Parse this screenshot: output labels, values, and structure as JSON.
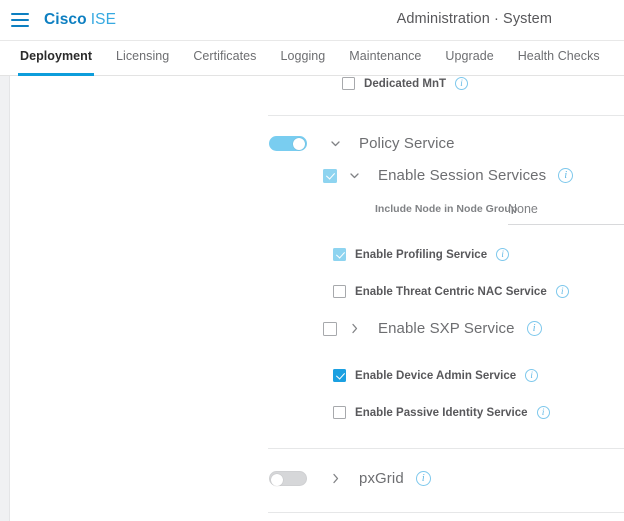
{
  "header": {
    "menu_icon": "hamburger-menu-icon",
    "brand_primary": "Cisco",
    "brand_secondary": "ISE",
    "breadcrumb": "Administration · System"
  },
  "tabs": [
    {
      "label": "Deployment",
      "active": true
    },
    {
      "label": "Licensing",
      "active": false
    },
    {
      "label": "Certificates",
      "active": false
    },
    {
      "label": "Logging",
      "active": false
    },
    {
      "label": "Maintenance",
      "active": false
    },
    {
      "label": "Upgrade",
      "active": false
    },
    {
      "label": "Health Checks",
      "active": false
    }
  ],
  "form": {
    "dedicated_mnt": {
      "label": "Dedicated MnT",
      "checked": false,
      "info_icon": "info-icon"
    },
    "policy_service": {
      "label": "Policy Service",
      "toggle_state": "on",
      "chevron": "chevron-down-icon"
    },
    "session_services": {
      "label": "Enable Session Services",
      "checked": true,
      "chevron": "chevron-down-icon",
      "info_icon": "info-icon"
    },
    "node_group": {
      "label": "Include Node in Node Group",
      "value": "None"
    },
    "profiling_service": {
      "label": "Enable Profiling Service",
      "checked": true,
      "info_icon": "info-icon"
    },
    "threat_centric_nac": {
      "label": "Enable Threat Centric NAC Service",
      "checked": false,
      "info_icon": "info-icon"
    },
    "sxp_service": {
      "label": "Enable SXP Service",
      "checked": false,
      "chevron": "chevron-right-icon",
      "info_icon": "info-icon"
    },
    "device_admin_service": {
      "label": "Enable Device Admin Service",
      "checked": true,
      "info_icon": "info-icon"
    },
    "passive_identity_service": {
      "label": "Enable Passive Identity Service",
      "checked": false,
      "info_icon": "info-icon"
    },
    "pxgrid": {
      "label": "pxGrid",
      "toggle_state": "off",
      "chevron": "chevron-right-icon",
      "info_icon": "info-icon"
    }
  },
  "colors": {
    "brand_blue": "#0d7fc1",
    "accent_blue": "#36a9e1",
    "tab_underline": "#0d9ddb",
    "toggle_on": "#79cdf0",
    "checkbox_light": "#8ed4f0",
    "checkbox_strong": "#1ba0e1"
  }
}
